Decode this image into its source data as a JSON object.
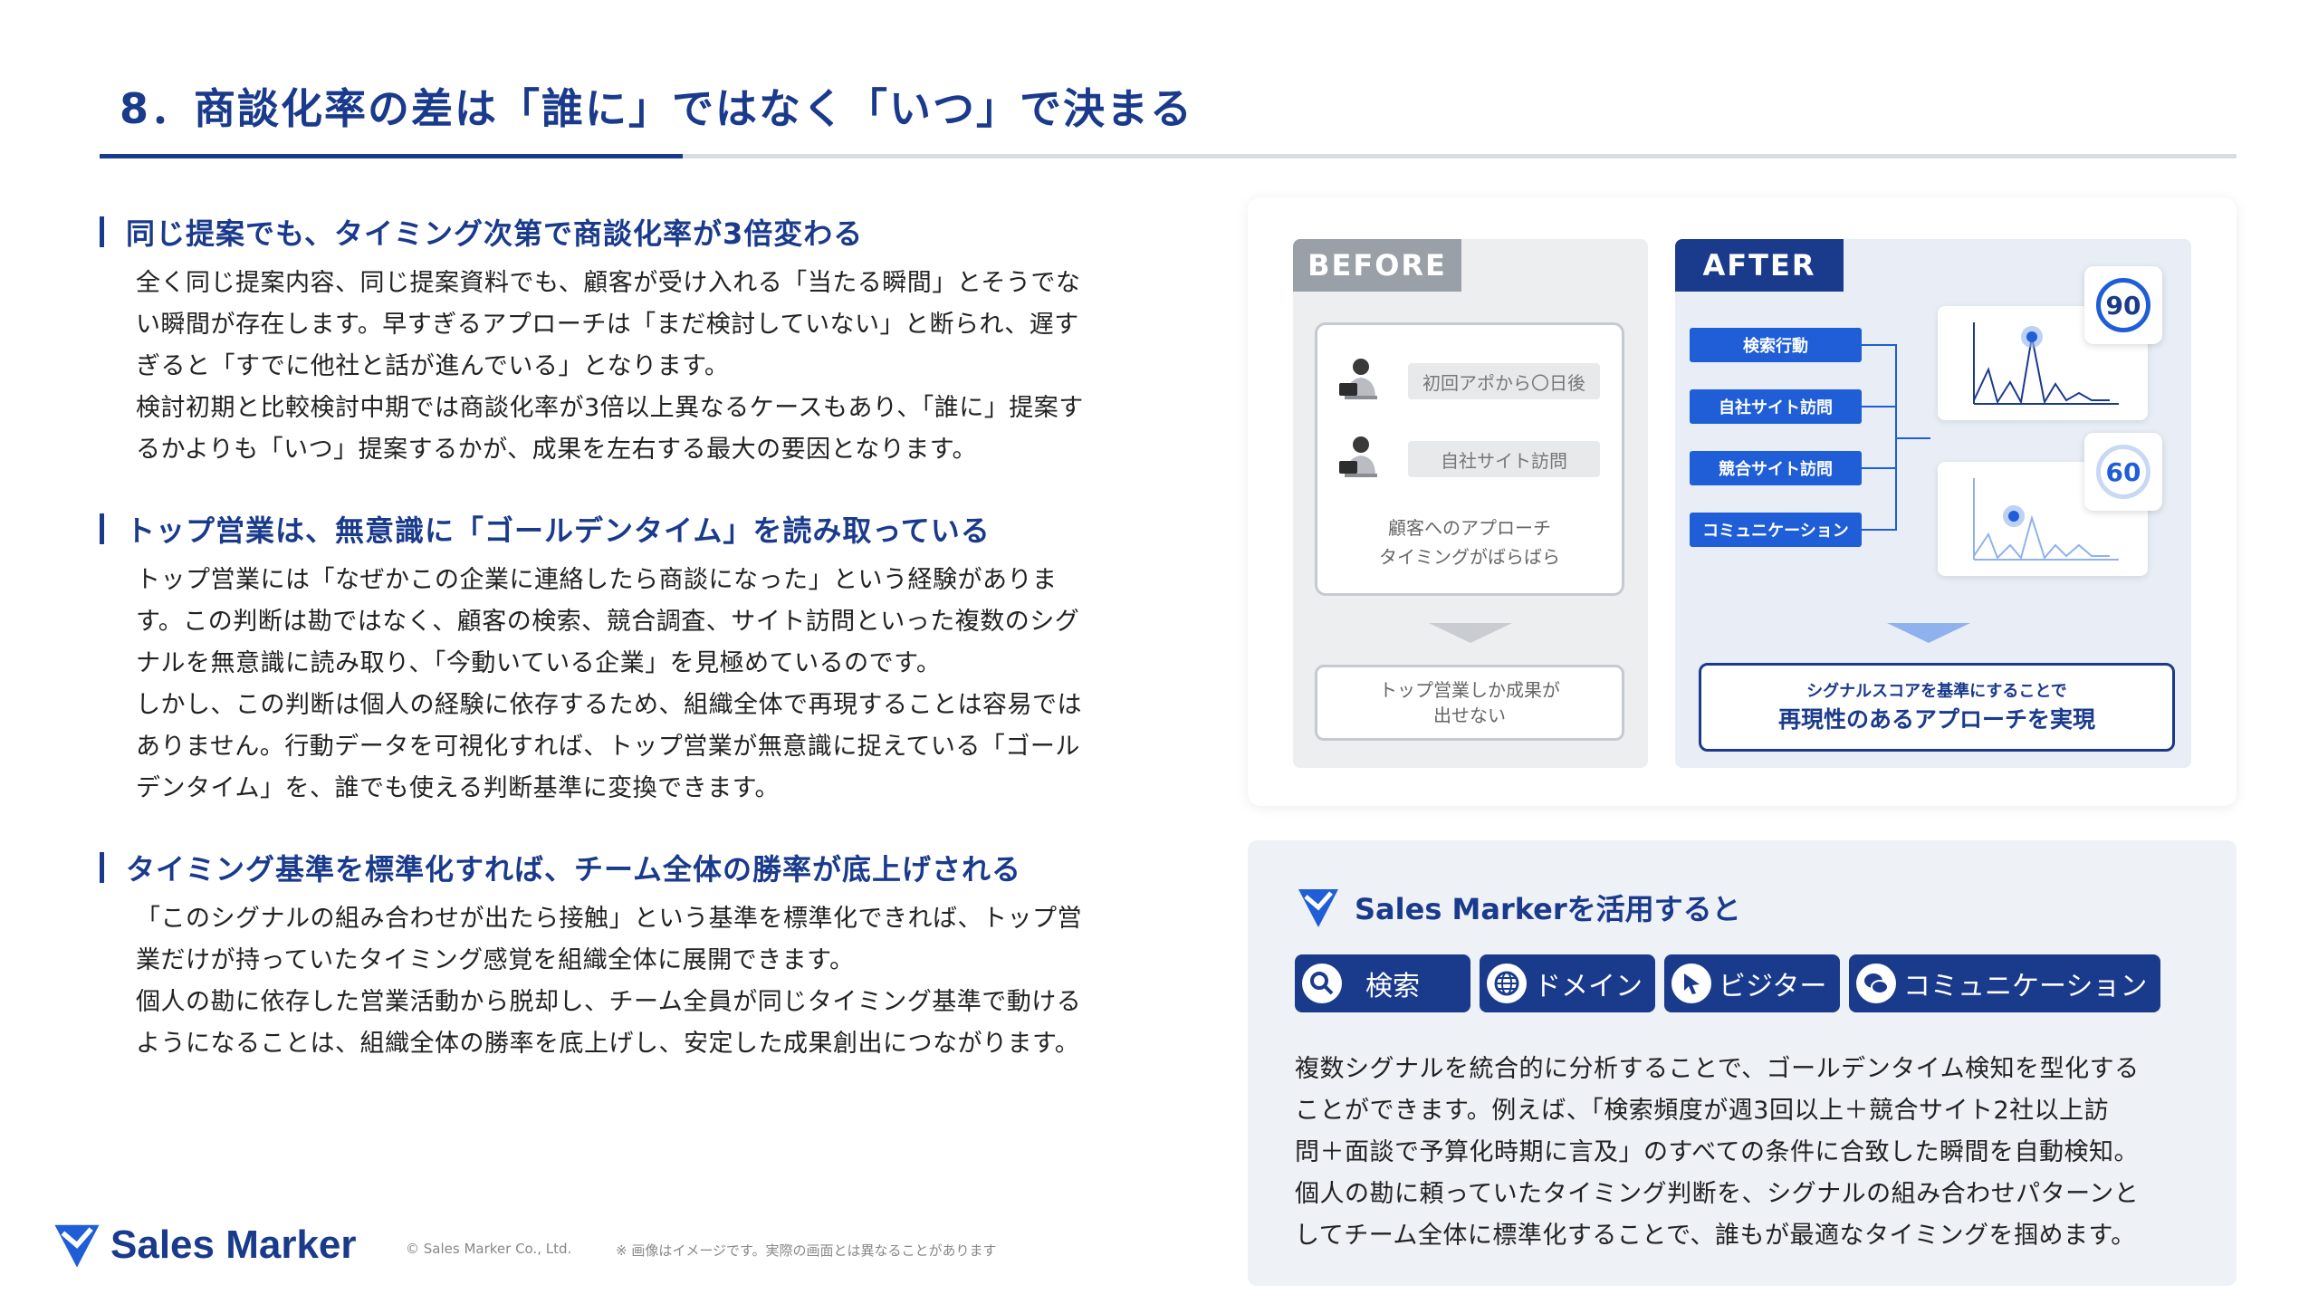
{
  "title": "8．商談化率の差は「誰に」ではなく「いつ」で決まる",
  "sections": [
    {
      "heading": "同じ提案でも、タイミング次第で商談化率が3倍変わる",
      "lines": [
        "全く同じ提案内容、同じ提案資料でも、顧客が受け入れる「当たる瞬間」とそうでな",
        "い瞬間が存在します。早すぎるアプローチは「まだ検討していない」と断られ、遅す",
        "ぎると「すでに他社と話が進んでいる」となります。",
        "検討初期と比較検討中期では商談化率が3倍以上異なるケースもあり、「誰に」提案す",
        "るかよりも「いつ」提案するかが、成果を左右する最大の要因となります。"
      ]
    },
    {
      "heading": "トップ営業は、無意識に「ゴールデンタイム」を読み取っている",
      "lines": [
        "トップ営業には「なぜかこの企業に連絡したら商談になった」という経験がありま",
        "す。この判断は勘ではなく、顧客の検索、競合調査、サイト訪問といった複数のシグ",
        "ナルを無意識に読み取り、「今動いている企業」を見極めているのです。",
        "しかし、この判断は個人の経験に依存するため、組織全体で再現することは容易では",
        "ありません。行動データを可視化すれば、トップ営業が無意識に捉えている「ゴール",
        "デンタイム」を、誰でも使える判断基準に変換できます。"
      ]
    },
    {
      "heading": "タイミング基準を標準化すれば、チーム全体の勝率が底上げされる",
      "lines": [
        "「このシグナルの組み合わせが出たら接触」という基準を標準化できれば、トップ営",
        "業だけが持っていたタイミング感覚を組織全体に展開できます。",
        "個人の勘に依存した営業活動から脱却し、チーム全員が同じタイミング基準で動ける",
        "ようになることは、組織全体の勝率を底上げし、安定した成果創出につながります。"
      ]
    }
  ],
  "before": {
    "tag": "BEFORE",
    "chip1": "初回アポから〇日後",
    "chip2": "自社サイト訪問",
    "caption_line1": "顧客へのアプローチ",
    "caption_line2": "タイミングがばらばら",
    "result_line1": "トップ営業しか成果が",
    "result_line2": "出せない"
  },
  "after": {
    "tag": "AFTER",
    "signals": [
      "検索行動",
      "自社サイト訪問",
      "競合サイト訪問",
      "コミュニケーション"
    ],
    "score_high": "90",
    "score_low": "60",
    "result_small": "シグナルスコアを基準にすることで",
    "result_big": "再現性のあるアプローチを実現"
  },
  "sales_marker": {
    "heading": "Sales Markerを活用すると",
    "buttons": [
      {
        "label": "検索",
        "icon": "search-icon"
      },
      {
        "label": "ドメイン",
        "icon": "globe-icon"
      },
      {
        "label": "ビジター",
        "icon": "cursor-icon"
      },
      {
        "label": "コミュニケーション",
        "icon": "chat-icon"
      }
    ],
    "lines": [
      "複数シグナルを統合的に分析することで、ゴールデンタイム検知を型化する",
      "ことができます。例えば、「検索頻度が週3回以上＋競合サイト2社以上訪",
      "問＋面談で予算化時期に言及」のすべての条件に合致した瞬間を自動検知。",
      "個人の勘に頼っていたタイミング判断を、シグナルの組み合わせパターンと",
      "してチーム全体に標準化することで、誰もが最適なタイミングを掴めます。"
    ]
  },
  "footer": {
    "logo_text": "Sales Marker",
    "copyright": "© Sales Marker Co., Ltd.",
    "disclaimer": "※ 画像はイメージです。実際の画面とは異なることがあります"
  },
  "colors": {
    "brand_navy": "#1a3a8c",
    "signal_blue": "#1f5ed6",
    "grey_tag": "#9aa0a8"
  }
}
